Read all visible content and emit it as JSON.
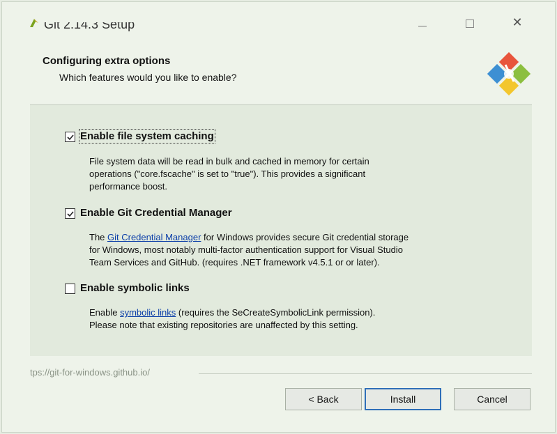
{
  "window": {
    "title": "Git 2.14.3 Setup",
    "minimize_icon": "minimize-icon",
    "maximize_icon": "maximize-icon",
    "close_glyph": "✕"
  },
  "header": {
    "title": "Configuring extra options",
    "subtitle": "Which features would you like to enable?",
    "logo_icon": "git-logo"
  },
  "options": [
    {
      "label": "Enable file system caching",
      "checked": true,
      "description": [
        "File system data will be read in bulk and cached in memory for certain",
        "operations (\"core.fscache\" is set to \"true\"). This provides a significant",
        "performance boost."
      ]
    },
    {
      "label": "Enable Git Credential Manager",
      "checked": true,
      "description_before_link": "The ",
      "description_link": "Git Credential Manager",
      "description_after_link": " for Windows provides secure Git credential storage",
      "description_lines": [
        "for Windows, most notably multi-factor authentication support for Visual Studio",
        "Team Services and GitHub. (requires .NET framework v4.5.1 or or later)."
      ]
    },
    {
      "label": "Enable symbolic links",
      "checked": false,
      "description_before_link": "Enable ",
      "description_link": "symbolic links",
      "description_after_link": " (requires the SeCreateSymbolicLink permission).",
      "description_lines": [
        "Please note that existing repositories are unaffected by this setting."
      ]
    }
  ],
  "footer": {
    "url": "tps://git-for-windows.github.io/"
  },
  "buttons": {
    "back": "< Back",
    "install": "Install",
    "cancel": "Cancel"
  },
  "colors": {
    "link": "#0b3ea8",
    "default_button_border": "#2f6fb8"
  }
}
